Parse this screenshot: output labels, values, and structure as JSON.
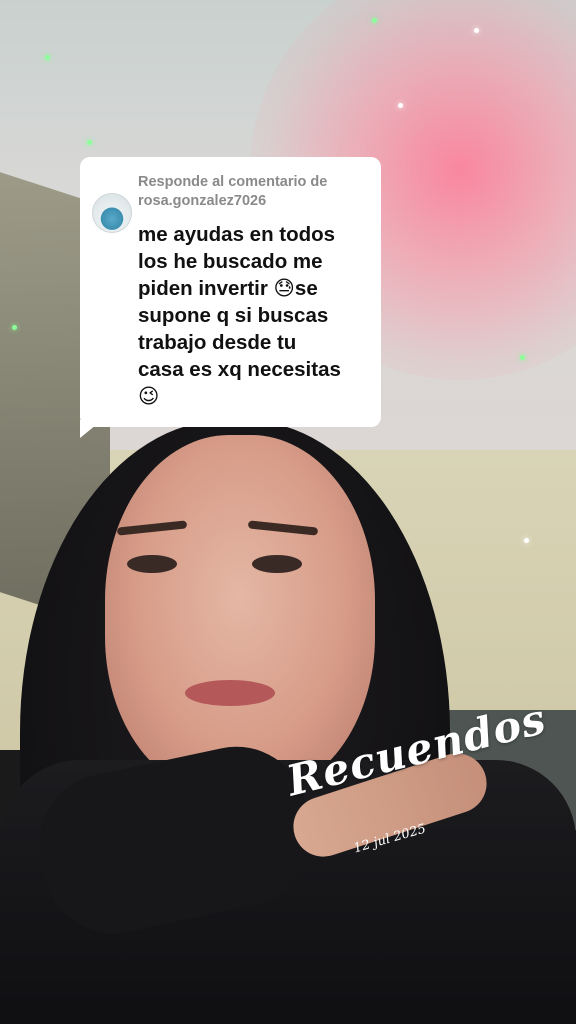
{
  "comment_card": {
    "reply_label_line1": "Responde al comentario de",
    "reply_label_line2": "rosa.gonzalez7026",
    "comment_text": "me ayudas en todos\nlos he buscado me\npiden invertir 😓se\nsupone q si buscas\ntrabajo desde tu\ncasa es xq necesitas\n😉"
  },
  "overlay": {
    "title": "Recuendos",
    "date": "12 jul 2025"
  }
}
